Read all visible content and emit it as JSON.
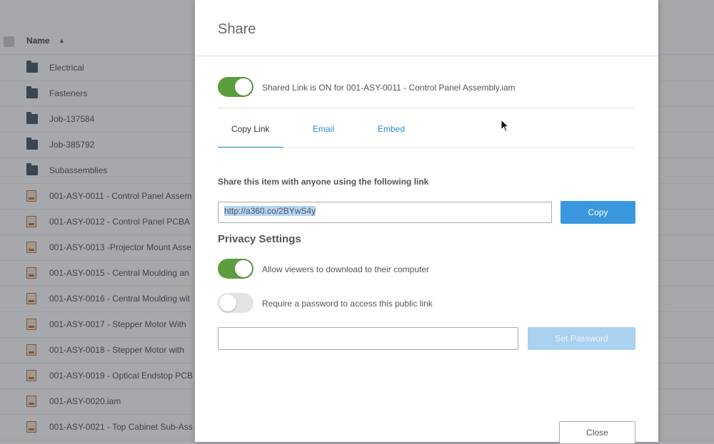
{
  "file_list": {
    "column_header": "Name",
    "sort_indicator": "▲",
    "rows": [
      {
        "type": "folder",
        "label": "Electrical"
      },
      {
        "type": "folder",
        "label": "Fasteners"
      },
      {
        "type": "folder",
        "label": "Job-137584"
      },
      {
        "type": "folder",
        "label": "Job-385792"
      },
      {
        "type": "folder",
        "label": "Subassemblies"
      },
      {
        "type": "file",
        "label": "001-ASY-0011 - Control Panel Assem"
      },
      {
        "type": "file",
        "label": "001-ASY-0012 - Control Panel PCBA"
      },
      {
        "type": "file",
        "label": "001-ASY-0013 -Projector Mount Asse"
      },
      {
        "type": "file",
        "label": "001-ASY-0015 - Central Moulding an"
      },
      {
        "type": "file",
        "label": "001-ASY-0016 - Central Moulding wit"
      },
      {
        "type": "file",
        "label": "001-ASY-0017 - Stepper Motor With"
      },
      {
        "type": "file",
        "label": "001-ASY-0018 - Stepper Motor with"
      },
      {
        "type": "file",
        "label": "001-ASY-0019 - Optical Endstop PCB"
      },
      {
        "type": "file",
        "label": "001-ASY-0020.iam"
      },
      {
        "type": "file",
        "label": "001-ASY-0021 - Top Cabinet Sub-Ass"
      }
    ]
  },
  "modal": {
    "title": "Share",
    "shared_link_status": "Shared Link is ON for 001-ASY-0011 - Control Panel Assembly.iam",
    "tabs": [
      {
        "label": "Copy Link",
        "active": true
      },
      {
        "label": "Email",
        "active": false
      },
      {
        "label": "Embed",
        "active": false
      }
    ],
    "share_instruction": "Share this item with anyone using the following link",
    "link_value": "http://a360.co/2BYwS4y",
    "copy_label": "Copy",
    "privacy_title": "Privacy Settings",
    "allow_download_label": "Allow viewers to download to their computer",
    "allow_download_on": true,
    "require_password_label": "Require a password to access this public link",
    "require_password_on": false,
    "password_value": "",
    "set_password_label": "Set Password",
    "close_label": "Close"
  },
  "colors": {
    "toggle_on": "#5c9e3e",
    "primary_button": "#3a97dd",
    "link_tab": "#2b8ed3"
  }
}
